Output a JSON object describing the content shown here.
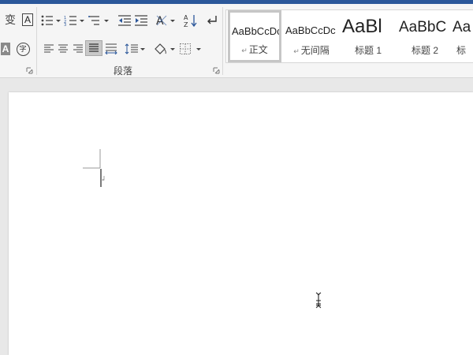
{
  "ribbon": {
    "paragraph_group_label": "段落",
    "font_group_partial_glyph": "A",
    "phonetic_glyph": "变",
    "encircle_glyph": "字",
    "sort_glyph": "A↓"
  },
  "styles": [
    {
      "sample": "AaBbCcDc",
      "name": "正文",
      "selected": true
    },
    {
      "sample": "AaBbCcDc",
      "name": "无间隔",
      "selected": false
    },
    {
      "sample": "AaBl",
      "name": "标题 1",
      "selected": false
    },
    {
      "sample": "AaBbC",
      "name": "标题 2",
      "selected": false
    },
    {
      "sample": "Aa",
      "name": "标",
      "selected": false
    }
  ],
  "colors": {
    "title_bar": "#2b579a",
    "ribbon_bg": "#f5f5f5",
    "canvas_bg": "#e8e8e8",
    "page_bg": "#ffffff"
  }
}
